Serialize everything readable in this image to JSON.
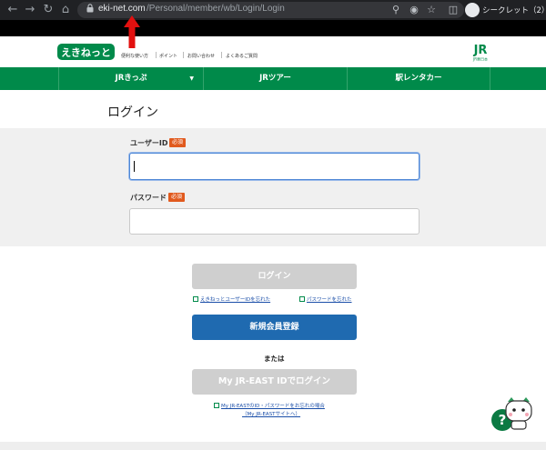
{
  "browser": {
    "url_host": "eki-net.com",
    "url_path": "/Personal/member/wb/Login/Login",
    "profile_label": "シークレット（2）"
  },
  "header": {
    "logo_text": "えきねっと",
    "links": [
      "便利な使い方",
      "ポイント",
      "お問い合わせ",
      "よくあるご質問"
    ],
    "jr_logo_text": "JR",
    "jr_logo_sub": "JR東日本"
  },
  "nav": {
    "items": [
      {
        "label": "JRきっぷ",
        "has_dropdown": true
      },
      {
        "label": "JRツアー",
        "has_dropdown": false
      },
      {
        "label": "駅レンタカー",
        "has_dropdown": false
      }
    ]
  },
  "page": {
    "title": "ログイン"
  },
  "form": {
    "userid_label": "ユーザーID",
    "password_label": "パスワード",
    "required_badge": "必須",
    "userid_value": "",
    "password_value": ""
  },
  "actions": {
    "login_label": "ログイン",
    "forgot_userid": "えきねっとユーザーIDを忘れた",
    "forgot_password": "パスワードを忘れた",
    "register_label": "新規会員登録",
    "or_text": "または",
    "jreast_login_label": "My JR-EAST IDでログイン",
    "jreast_forgot_line1": "My JR-EASTのID・パスワードをお忘れの場合",
    "jreast_forgot_line2": "（My JR-EASTサイトへ）"
  },
  "help": {
    "symbol": "?"
  },
  "colors": {
    "brand_green": "#008a4a",
    "primary_blue": "#1f6ab0",
    "required_orange": "#e15a1e",
    "disabled_gray": "#cfcfcf",
    "annotation_red": "#e3100f"
  }
}
